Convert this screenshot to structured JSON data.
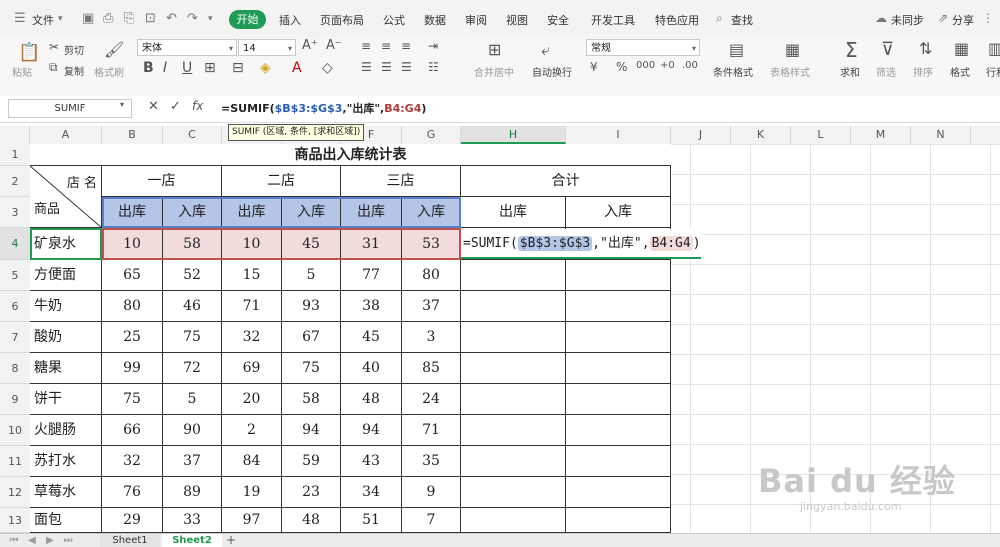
{
  "menubar": {
    "file": "文件",
    "tabs": [
      "开始",
      "插入",
      "页面布局",
      "公式",
      "数据",
      "审阅",
      "视图",
      "安全",
      "开发工具",
      "特色应用"
    ],
    "search": "查找",
    "sync": "未同步",
    "share": "分享"
  },
  "ribbon": {
    "paste": "粘贴",
    "cut": "剪切",
    "copy": "复制",
    "format_painter": "格式刷",
    "font_name": "宋体",
    "font_size": "14",
    "merge_center": "合并居中",
    "auto_wrap": "自动换行",
    "number_format": "常规",
    "cond_format": "条件格式",
    "table_style": "表格样式",
    "sum": "求和",
    "filter": "筛选",
    "sort": "排序",
    "format": "格式",
    "row_col": "行和"
  },
  "formula_bar": {
    "name_box": "SUMIF",
    "fx": "fx",
    "formula_prefix": "=SUMIF(",
    "formula_ref1": "$B$3:$G$3",
    "formula_mid": ",\"出库\",",
    "formula_ref2": "B4:G4",
    "formula_suffix": ")",
    "tooltip": "SUMIF (区域, 条件, [求和区域])"
  },
  "columns": [
    "A",
    "B",
    "C",
    "D",
    "E",
    "F",
    "G",
    "H",
    "I",
    "J",
    "K",
    "L",
    "M",
    "N"
  ],
  "rows": [
    "1",
    "2",
    "3",
    "4",
    "5",
    "6",
    "7",
    "8",
    "9",
    "10",
    "11",
    "12",
    "13"
  ],
  "table": {
    "title": "商品出入库统计表",
    "corner_top": "店 名",
    "corner_bottom": "商品",
    "stores": [
      "一店",
      "二店",
      "三店",
      "合计"
    ],
    "sub_headers": [
      "出库",
      "入库",
      "出库",
      "入库",
      "出库",
      "入库",
      "出库",
      "入库"
    ],
    "data_rows": [
      {
        "name": "矿泉水",
        "values": [
          "10",
          "58",
          "10",
          "45",
          "31",
          "53"
        ]
      },
      {
        "name": "方便面",
        "values": [
          "65",
          "52",
          "15",
          "5",
          "77",
          "80"
        ]
      },
      {
        "name": "牛奶",
        "values": [
          "80",
          "46",
          "71",
          "93",
          "38",
          "37"
        ]
      },
      {
        "name": "酸奶",
        "values": [
          "25",
          "75",
          "32",
          "67",
          "45",
          "3"
        ]
      },
      {
        "name": "糖果",
        "values": [
          "99",
          "72",
          "69",
          "75",
          "40",
          "85"
        ]
      },
      {
        "name": "饼干",
        "values": [
          "75",
          "5",
          "20",
          "58",
          "48",
          "24"
        ]
      },
      {
        "name": "火腿肠",
        "values": [
          "66",
          "90",
          "2",
          "94",
          "94",
          "71"
        ]
      },
      {
        "name": "苏打水",
        "values": [
          "32",
          "37",
          "84",
          "59",
          "43",
          "35"
        ]
      },
      {
        "name": "草莓水",
        "values": [
          "76",
          "89",
          "19",
          "23",
          "34",
          "9"
        ]
      },
      {
        "name": "面包",
        "values": [
          "29",
          "33",
          "97",
          "48",
          "51",
          "7"
        ]
      }
    ],
    "edit_cell": {
      "prefix": "=SUMIF(",
      "ref1": "$B$3:$G$3",
      "mid": ",\"出库\",",
      "ref2": "B4:G4",
      "suffix": ")"
    }
  },
  "sheets": [
    "Sheet1",
    "Sheet2"
  ],
  "watermark": {
    "main": "Bai du 经验",
    "sub": "jingyan.baidu.com"
  }
}
